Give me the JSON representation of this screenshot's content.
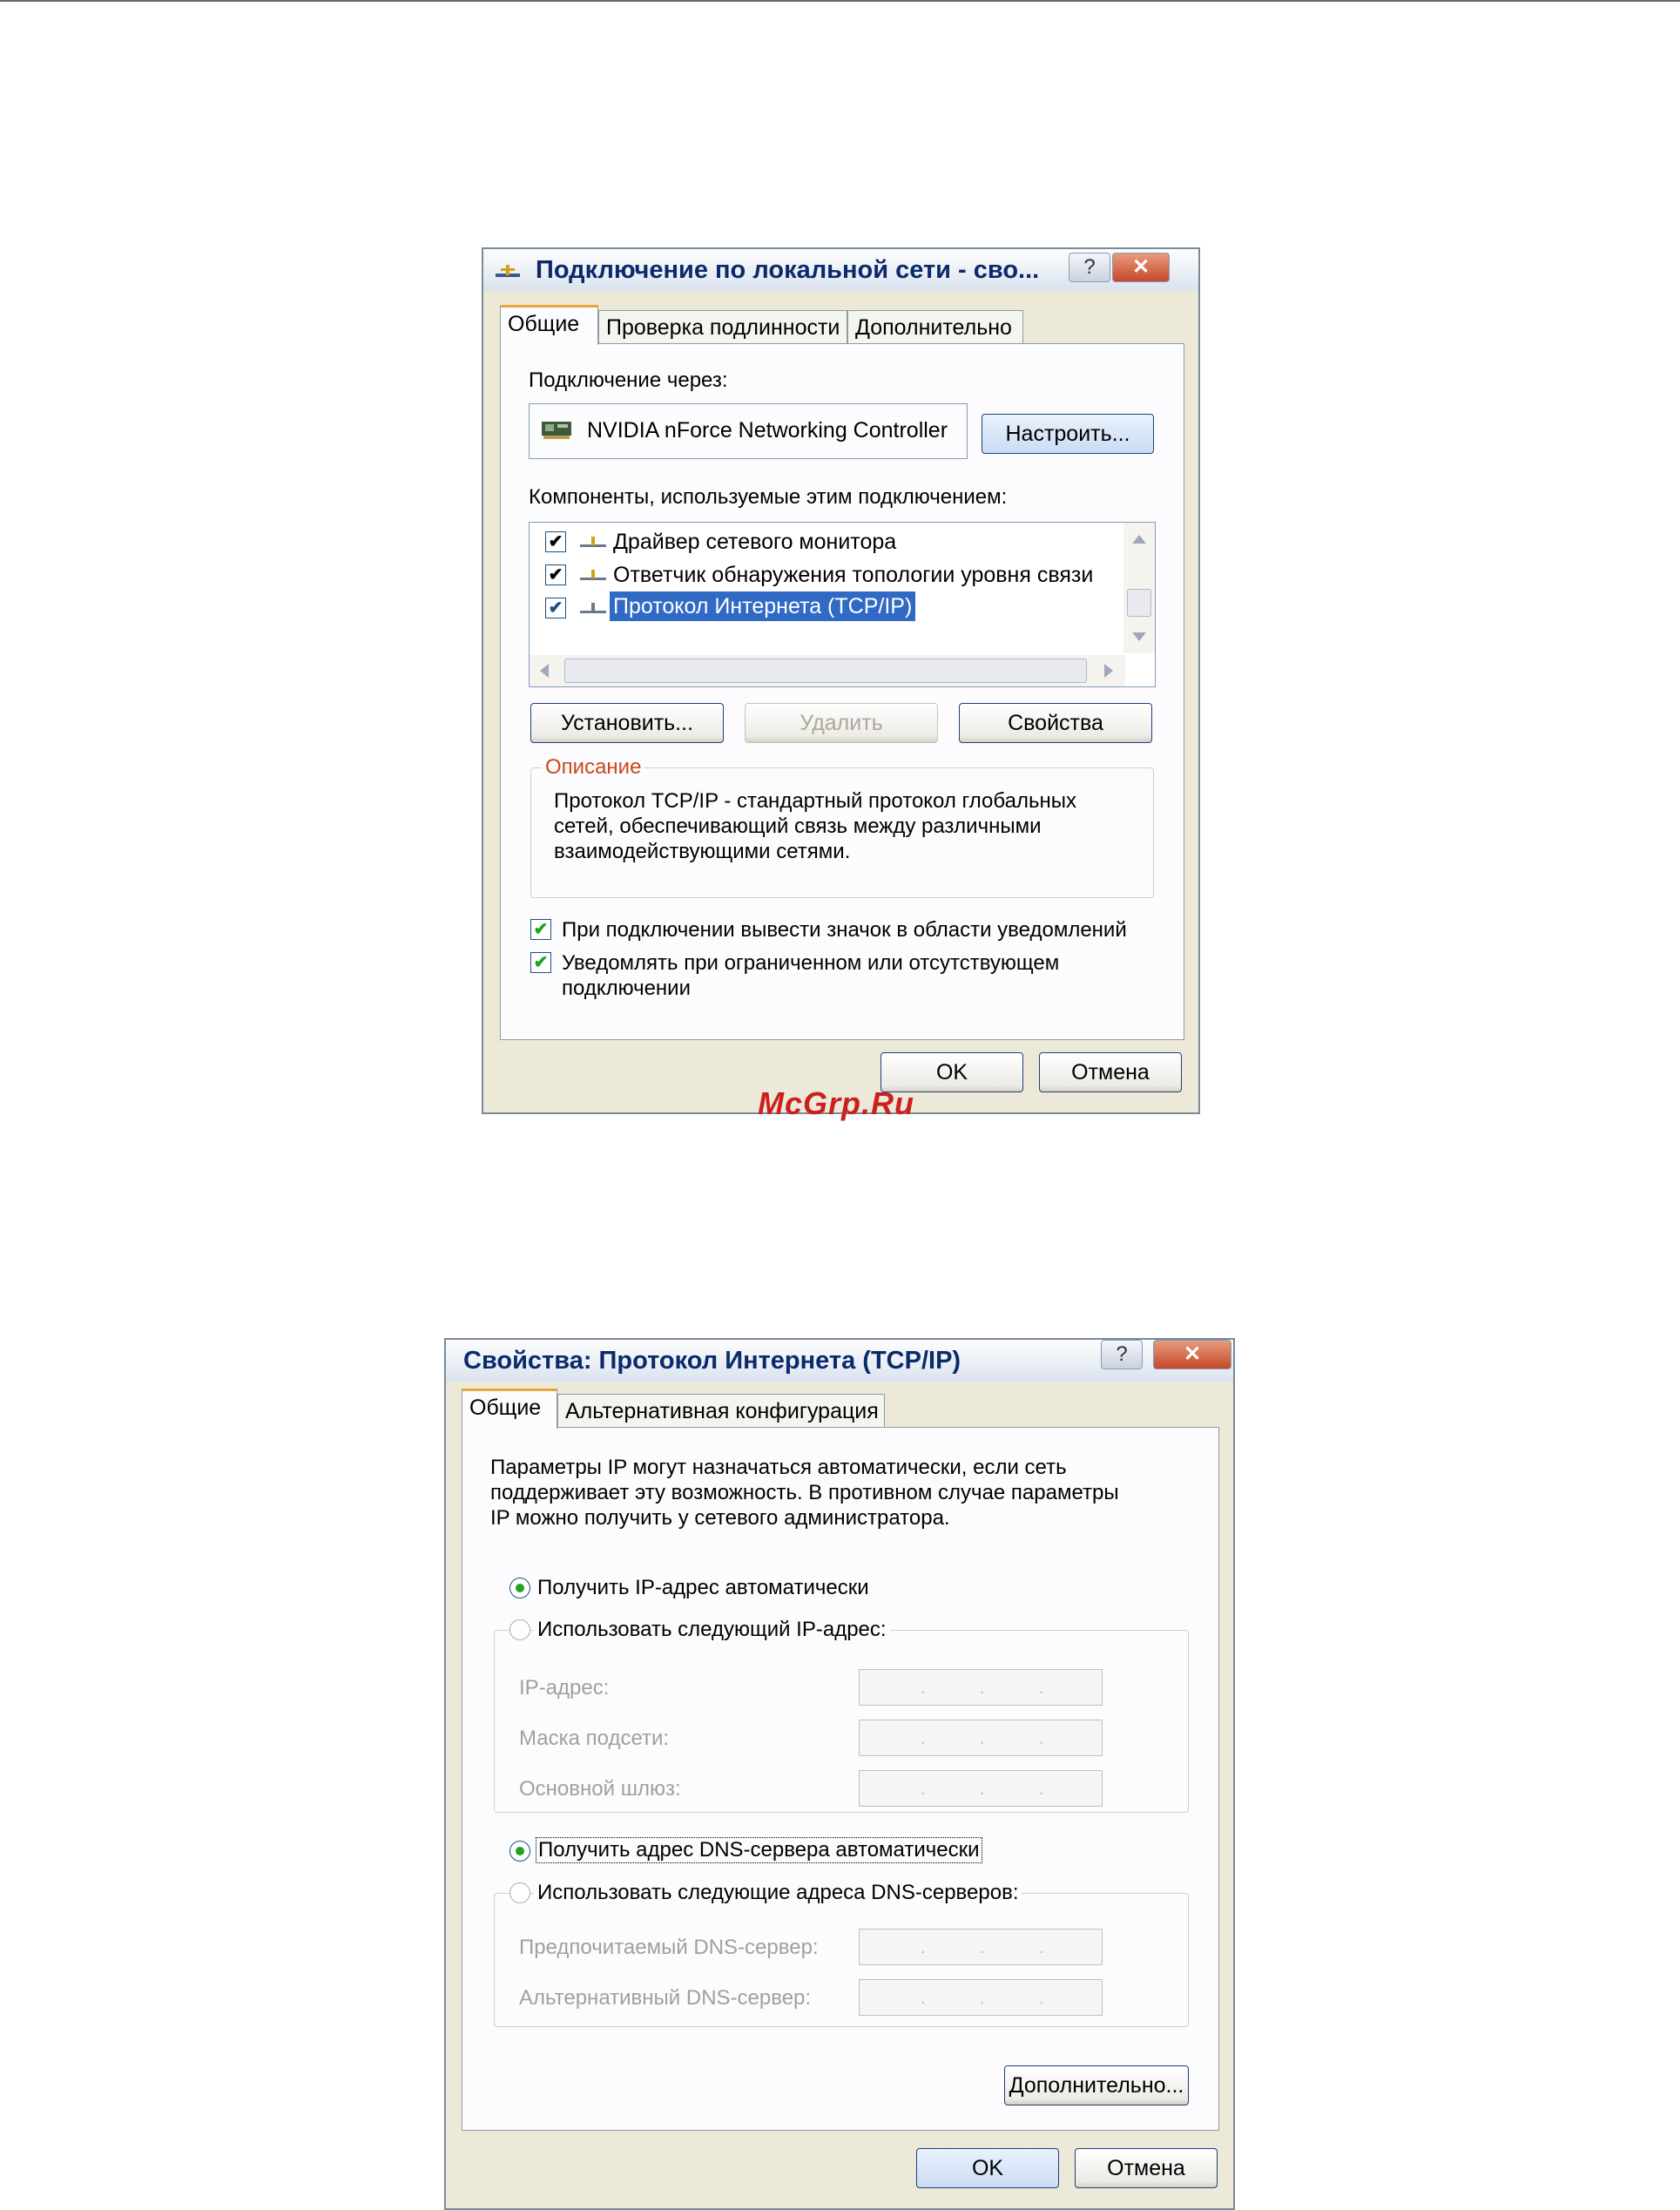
{
  "dialog1": {
    "title": "Подключение по локальной сети - сво...",
    "help_glyph": "?",
    "close_glyph": "✕",
    "tabs": [
      "Общие",
      "Проверка подлинности",
      "Дополнительно"
    ],
    "connect_via_label": "Подключение через:",
    "adapter_name": "NVIDIA nForce Networking Controller",
    "configure_button": "Настроить...",
    "components_label": "Компоненты, используемые этим подключением:",
    "components": [
      {
        "label": "Драйвер сетевого монитора",
        "checked": true
      },
      {
        "label": "Ответчик обнаружения топологии уровня связи",
        "checked": true
      },
      {
        "label": "Протокол Интернета (TCP/IP)",
        "checked": true,
        "selected": true
      }
    ],
    "install_button": "Установить...",
    "remove_button": "Удалить",
    "properties_button": "Свойства",
    "description_title": "Описание",
    "description_lines": [
      "Протокол TCP/IP - стандартный протокол глобальных",
      "сетей, обеспечивающий связь между различными",
      "взаимодействующими сетями."
    ],
    "show_icon_label": "При подключении вывести значок в области уведомлений",
    "notify_label_1": "Уведомлять при ограниченном или отсутствующем",
    "notify_label_2": "подключении",
    "ok_button": "OK",
    "cancel_button": "Отмена"
  },
  "watermark": "McGrp.Ru",
  "dialog2": {
    "title": "Свойства: Протокол Интернета (TCP/IP)",
    "help_glyph": "?",
    "close_glyph": "✕",
    "tabs": [
      "Общие",
      "Альтернативная конфигурация"
    ],
    "intro_lines": [
      "Параметры IP могут назначаться автоматически, если сеть",
      "поддерживает эту возможность. В противном случае параметры",
      "IP можно получить у сетевого администратора."
    ],
    "auto_ip_label": "Получить IP-адрес автоматически",
    "manual_ip_label": "Использовать следующий IP-адрес:",
    "ip_address_label": "IP-адрес:",
    "subnet_mask_label": "Маска подсети:",
    "gateway_label": "Основной шлюз:",
    "auto_dns_label": "Получить адрес DNS-сервера автоматически",
    "manual_dns_label": "Использовать следующие адреса DNS-серверов:",
    "preferred_dns_label": "Предпочитаемый DNS-сервер:",
    "alternate_dns_label": "Альтернативный DNS-сервер:",
    "advanced_button": "Дополнительно...",
    "ok_button": "OK",
    "cancel_button": "Отмена",
    "ip_dot": "."
  }
}
